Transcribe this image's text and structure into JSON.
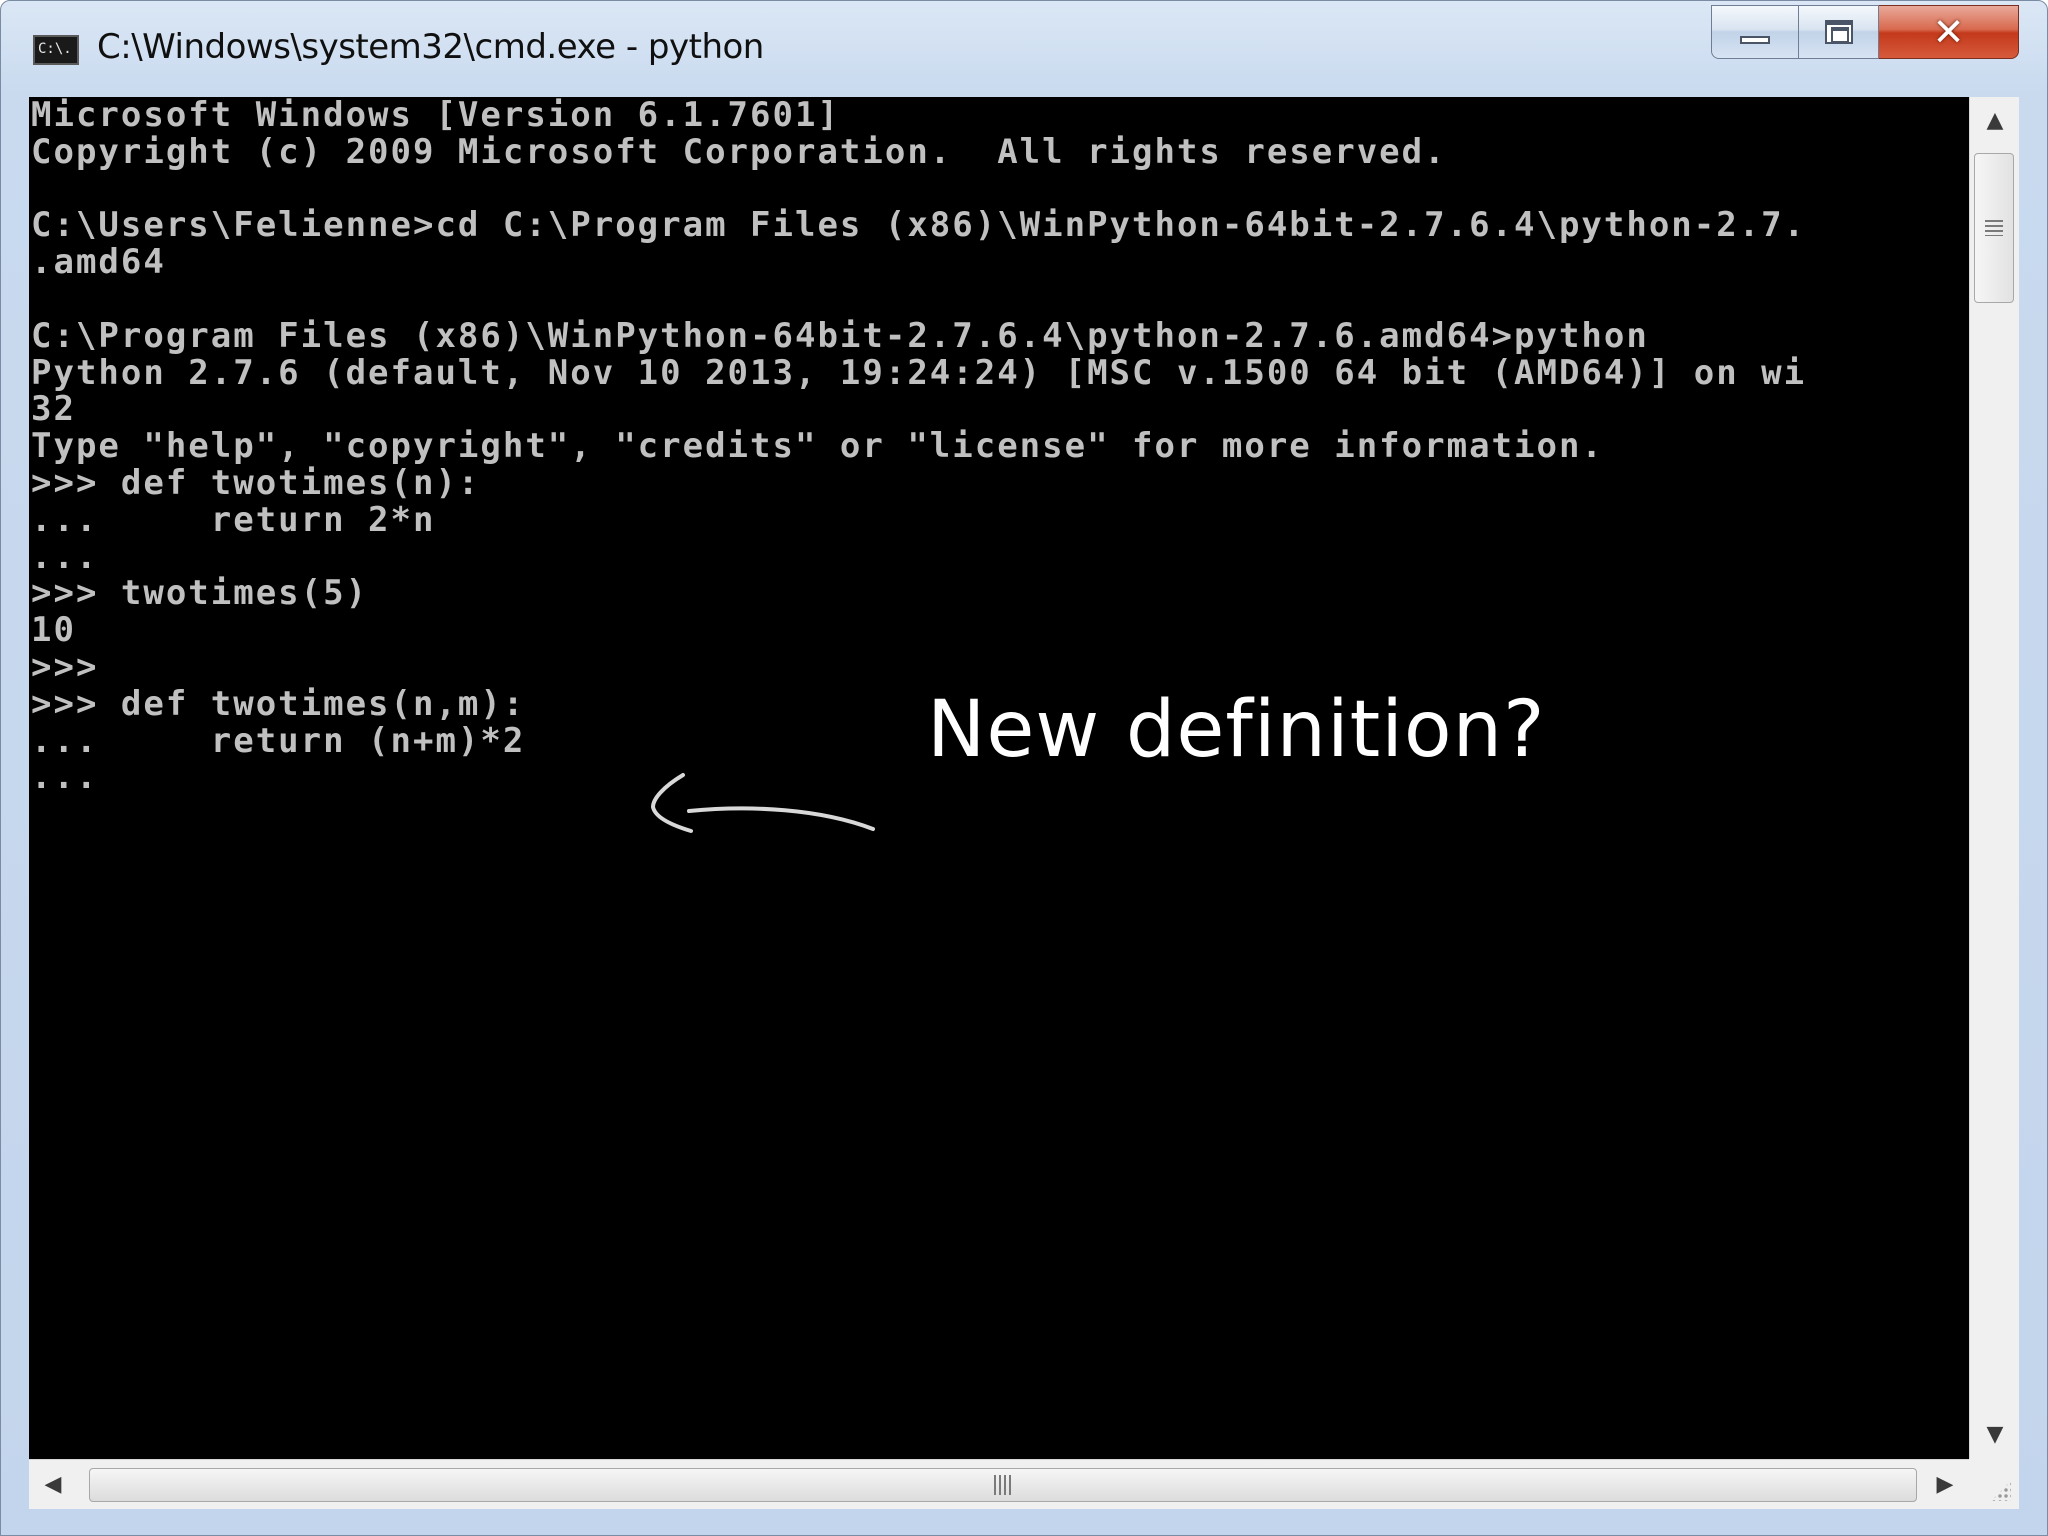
{
  "window": {
    "title": "C:\\Windows\\system32\\cmd.exe - python",
    "icon_label": "C:\\.",
    "icon": "cmd-icon",
    "controls": {
      "minimize": "minimize-icon",
      "maximize": "maximize-icon",
      "close": "close-icon",
      "close_glyph": "✕"
    }
  },
  "console": {
    "lines": [
      "Microsoft Windows [Version 6.1.7601]",
      "Copyright (c) 2009 Microsoft Corporation.  All rights reserved.",
      "",
      "C:\\Users\\Felienne>cd C:\\Program Files (x86)\\WinPython-64bit-2.7.6.4\\python-2.7.",
      ".amd64",
      "",
      "C:\\Program Files (x86)\\WinPython-64bit-2.7.6.4\\python-2.7.6.amd64>python",
      "Python 2.7.6 (default, Nov 10 2013, 19:24:24) [MSC v.1500 64 bit (AMD64)] on wi",
      "32",
      "Type \"help\", \"copyright\", \"credits\" or \"license\" for more information.",
      ">>> def twotimes(n):",
      "...     return 2*n",
      "...",
      ">>> twotimes(5)",
      "10",
      ">>>",
      ">>> def twotimes(n,m):",
      "...     return (n+m)*2",
      "..."
    ],
    "background": "#000000",
    "text_color": "#c0c0c0"
  },
  "annotation": {
    "text": "New definition?",
    "arrow_icon": "left-arrow-icon",
    "color": "#ffffff"
  },
  "scrollbars": {
    "up_glyph": "▲",
    "down_glyph": "▼",
    "left_glyph": "◀",
    "right_glyph": "▶"
  }
}
